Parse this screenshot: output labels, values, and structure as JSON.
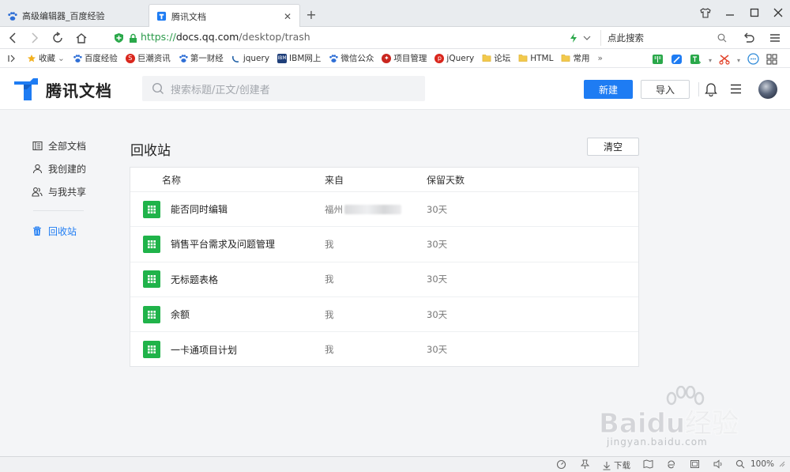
{
  "browser": {
    "tabs": [
      {
        "label": "高级编辑器_百度经验",
        "icon": "paw-icon"
      },
      {
        "label": "腾讯文档",
        "icon": "tencent-docs-icon"
      }
    ],
    "url": {
      "scheme": "https://",
      "host": "docs.qq.com",
      "path": "/desktop/trash"
    },
    "search_placeholder": "点此搜索",
    "bookmarks": [
      {
        "label": "收藏",
        "icon": "star-icon"
      },
      {
        "label": "百度经验",
        "icon": "paw-icon"
      },
      {
        "label": "巨潮资讯",
        "icon": "red-badge-icon"
      },
      {
        "label": "第一财经",
        "icon": "paw-icon"
      },
      {
        "label": "jquery",
        "icon": "jquery-icon"
      },
      {
        "label": "IBM网上",
        "icon": "ibm-icon"
      },
      {
        "label": "微信公众",
        "icon": "paw-icon"
      },
      {
        "label": "项目管理",
        "icon": "red-badge-icon"
      },
      {
        "label": "jQuery",
        "icon": "red-badge-icon"
      },
      {
        "label": "论坛",
        "icon": "folder-icon"
      },
      {
        "label": "HTML",
        "icon": "folder-icon"
      },
      {
        "label": "常用",
        "icon": "folder-icon"
      }
    ],
    "bookmarks_more": "»",
    "status": {
      "download": "下载",
      "zoom": "100%"
    }
  },
  "app": {
    "name": "腾讯文档",
    "search_placeholder": "搜索标题/正文/创建者",
    "new_button": "新建",
    "import_button": "导入"
  },
  "sidebar": {
    "items": [
      {
        "label": "全部文档",
        "icon": "documents-icon"
      },
      {
        "label": "我创建的",
        "icon": "user-icon"
      },
      {
        "label": "与我共享",
        "icon": "users-icon"
      }
    ],
    "trash": {
      "label": "回收站",
      "icon": "trash-icon"
    }
  },
  "main": {
    "title": "回收站",
    "clear_button": "清空",
    "columns": {
      "name": "名称",
      "from": "来自",
      "days": "保留天数"
    },
    "rows": [
      {
        "name": "能否同时编辑",
        "from": "福州",
        "days": "30天",
        "redacted": true
      },
      {
        "name": "销售平台需求及问题管理",
        "from": "我",
        "days": "30天"
      },
      {
        "name": "无标题表格",
        "from": "我",
        "days": "30天"
      },
      {
        "name": "余额",
        "from": "我",
        "days": "30天"
      },
      {
        "name": "一卡通项目计划",
        "from": "我",
        "days": "30天"
      }
    ]
  },
  "watermark": {
    "brand": "Baidu经验",
    "url": "jingyan.baidu.com"
  },
  "colors": {
    "accent": "#1e7cf3",
    "sheet": "#20b34a"
  }
}
